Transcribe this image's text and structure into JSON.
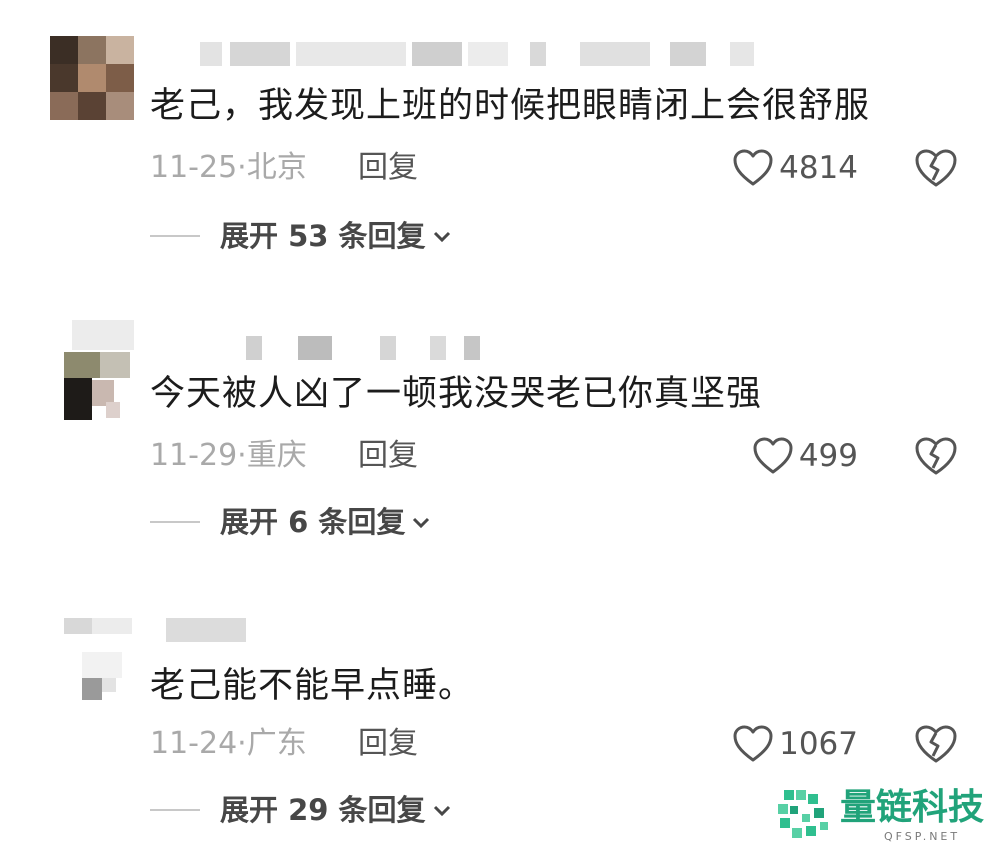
{
  "comments": [
    {
      "text": "老己，我发现上班的时候把眼睛闭上会很舒服",
      "meta": "11-25·北京",
      "reply_label": "回复",
      "likes": "4814",
      "expand_label": "展开 53 条回复"
    },
    {
      "text": "今天被人凶了一顿我没哭老已你真坚强",
      "meta": "11-29·重庆",
      "reply_label": "回复",
      "likes": "499",
      "expand_label": "展开 6 条回复"
    },
    {
      "text": "老己能不能早点睡。",
      "meta": "11-24·广东",
      "reply_label": "回复",
      "likes": "1067",
      "expand_label": "展开 29 条回复"
    }
  ],
  "icons": {
    "like": "heart-outline-icon",
    "dislike": "broken-heart-icon",
    "expand": "chevron-down-icon"
  },
  "watermark": {
    "text": "量链科技",
    "subtext": "QFSP.NET"
  },
  "colors": {
    "text": "#1c1c1c",
    "meta": "#a9a9a9",
    "action": "#555555",
    "watermark": "#21a37a"
  }
}
